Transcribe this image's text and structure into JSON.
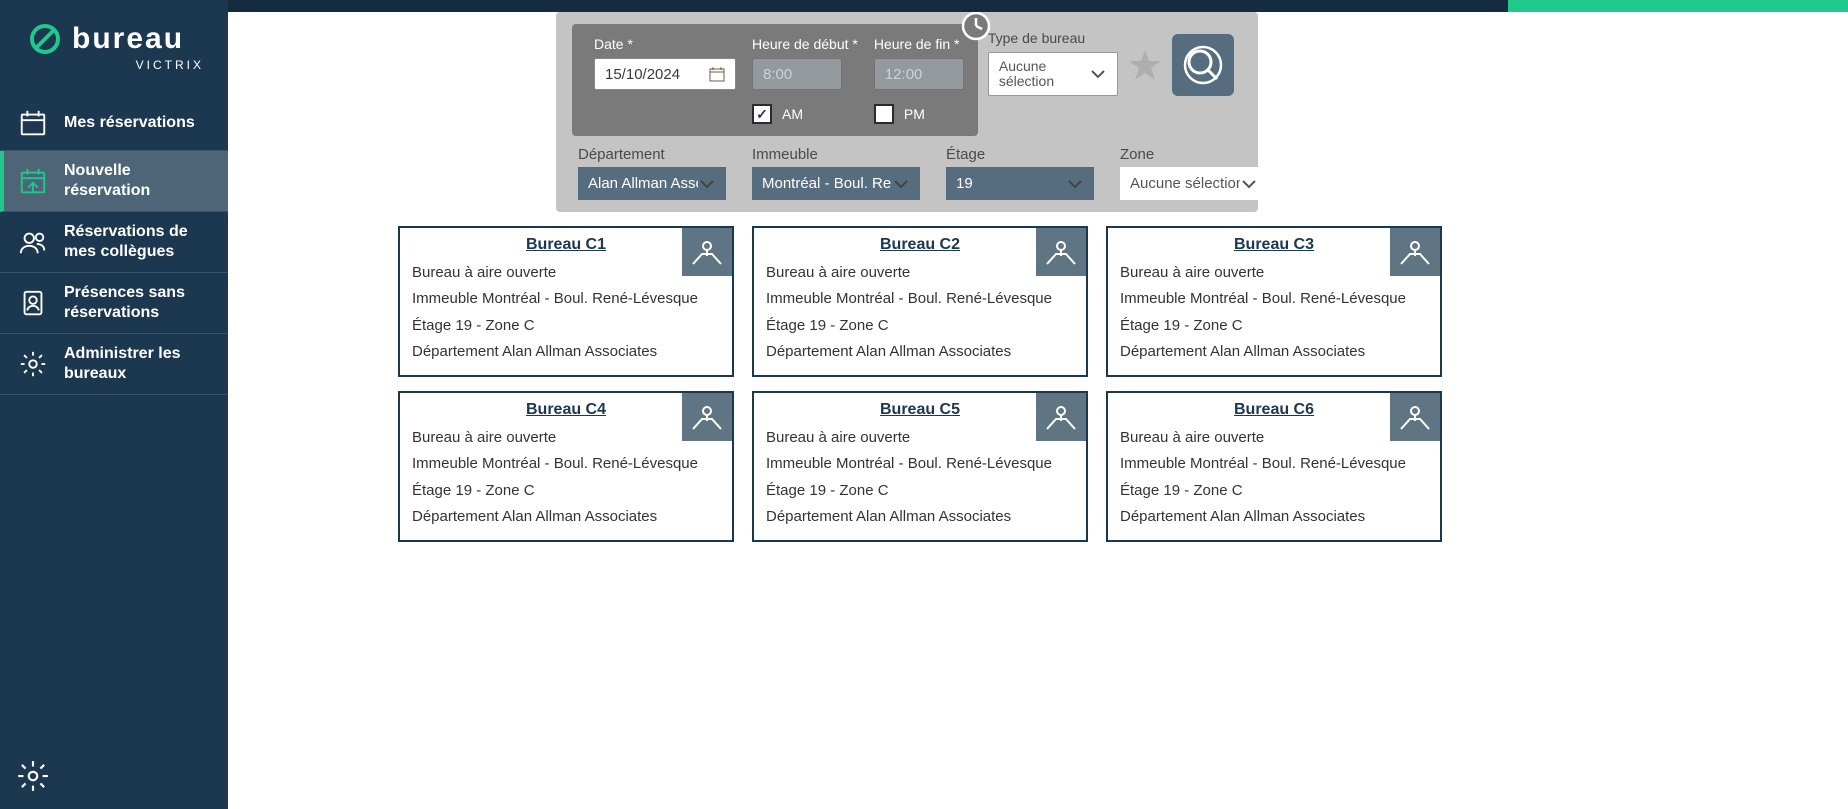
{
  "brand": {
    "name": "bureau",
    "sub": "VICTRIX"
  },
  "nav": {
    "items": [
      {
        "label": "Mes réservations"
      },
      {
        "label": "Nouvelle réservation"
      },
      {
        "label": "Réservations de mes collègues"
      },
      {
        "label": "Présences sans réservations"
      },
      {
        "label": "Administrer les bureaux"
      }
    ]
  },
  "filters": {
    "date_label": "Date *",
    "date_value": "15/10/2024",
    "start_label": "Heure de début *",
    "start_value": "8:00",
    "end_label": "Heure de fin *",
    "end_value": "12:00",
    "am_label": "AM",
    "pm_label": "PM",
    "am_checked": true,
    "pm_checked": false,
    "type_label": "Type de bureau",
    "type_value": "Aucune sélection",
    "dept_label": "Département",
    "dept_value": "Alan Allman Associates",
    "imm_label": "Immeuble",
    "imm_value": "Montréal - Boul. René-Lévesque",
    "etage_label": "Étage",
    "etage_value": "19",
    "zone_label": "Zone",
    "zone_value": "Aucune sélection"
  },
  "cards": [
    {
      "title": "Bureau C1",
      "type": "Bureau à aire ouverte",
      "imm": "Immeuble Montréal - Boul. René-Lévesque",
      "etage": "Étage 19 - Zone C",
      "dept": "Département Alan Allman Associates"
    },
    {
      "title": "Bureau C2",
      "type": "Bureau à aire ouverte",
      "imm": "Immeuble Montréal - Boul. René-Lévesque",
      "etage": "Étage 19 - Zone C",
      "dept": "Département Alan Allman Associates"
    },
    {
      "title": "Bureau C3",
      "type": "Bureau à aire ouverte",
      "imm": "Immeuble Montréal - Boul. René-Lévesque",
      "etage": "Étage 19 - Zone C",
      "dept": "Département Alan Allman Associates"
    },
    {
      "title": "Bureau C4",
      "type": "Bureau à aire ouverte",
      "imm": "Immeuble Montréal - Boul. René-Lévesque",
      "etage": "Étage 19 - Zone C",
      "dept": "Département Alan Allman Associates"
    },
    {
      "title": "Bureau C5",
      "type": "Bureau à aire ouverte",
      "imm": "Immeuble Montréal - Boul. René-Lévesque",
      "etage": "Étage 19 - Zone C",
      "dept": "Département Alan Allman Associates"
    },
    {
      "title": "Bureau C6",
      "type": "Bureau à aire ouverte",
      "imm": "Immeuble Montréal - Boul. René-Lévesque",
      "etage": "Étage 19 - Zone C",
      "dept": "Département Alan Allman Associates"
    }
  ]
}
